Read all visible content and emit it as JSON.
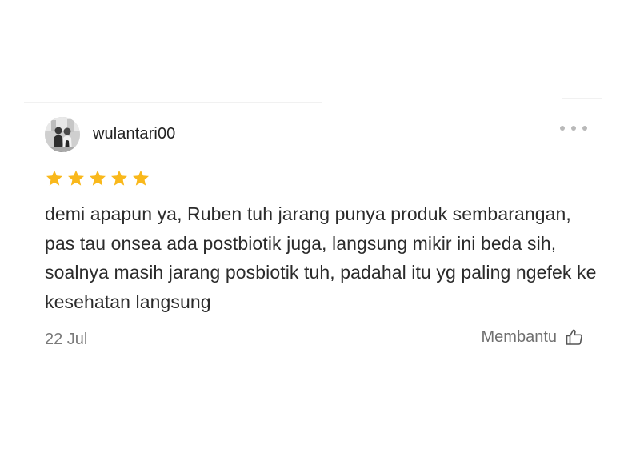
{
  "review": {
    "username": "wulantari00",
    "rating": 5,
    "rating_max": 5,
    "text": "demi apapun ya, Ruben tuh jarang punya produk sembarangan, pas tau onsea ada postbiotik juga, langsung mikir ini beda sih, soalnya masih jarang posbiotik tuh, padahal itu yg paling ngefek ke kesehatan langsung",
    "date": "22 Jul",
    "helpful_label": "Membantu"
  },
  "icons": {
    "avatar": "user-avatar-photo",
    "more": "more-dots-icon",
    "star": "star-icon",
    "helpful": "thumbs-up-icon"
  },
  "colors": {
    "star": "#F9B81B",
    "text": "#2b2b2b",
    "muted": "#7a7a7a"
  }
}
